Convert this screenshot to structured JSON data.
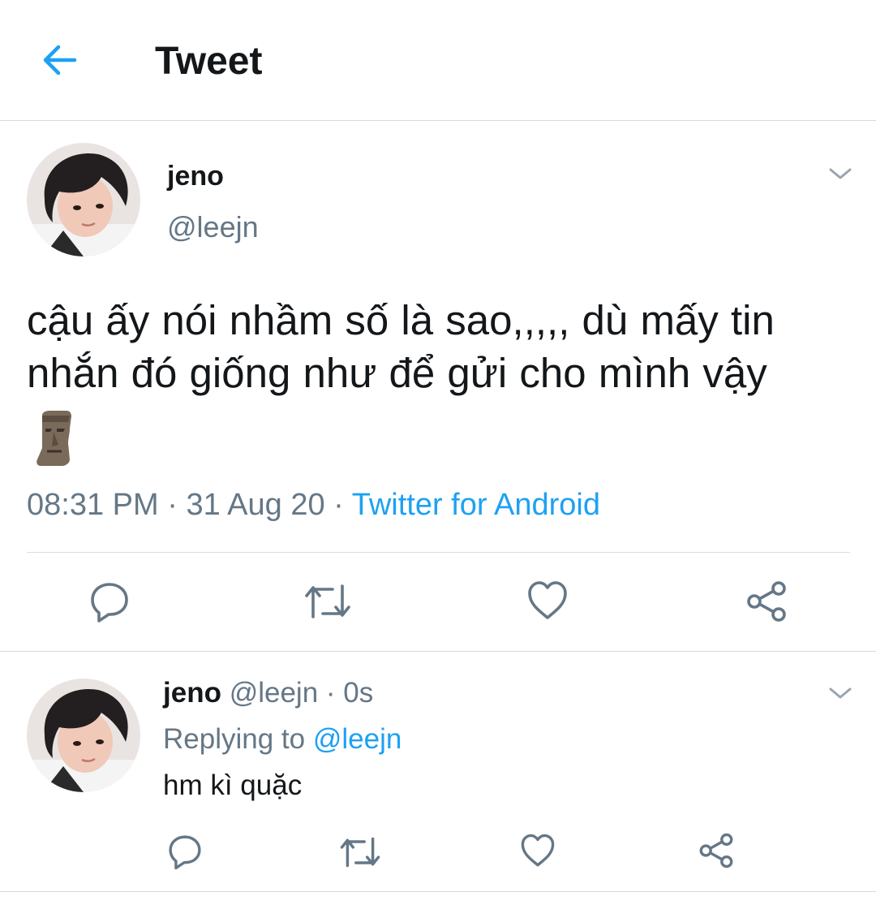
{
  "header": {
    "title": "Tweet",
    "back_icon": "arrow-left-icon"
  },
  "tweet": {
    "author_name": "jeno",
    "author_handle": "@leejn",
    "text": "cậu ấy nói nhầm số là sao,,,,, dù mấy tin nhắn đó giống như để gửi cho mình vậy",
    "emoji_icon": "moai-icon",
    "time": "08:31 PM",
    "separator": " · ",
    "date": "31 Aug 20",
    "source": "Twitter for Android",
    "actions": [
      "reply-icon",
      "retweet-icon",
      "like-icon",
      "share-icon"
    ]
  },
  "reply": {
    "author_name": "jeno",
    "author_handle": "@leejn",
    "time_ago": "0s",
    "replying_label": "Replying to",
    "replying_to": "@leejn",
    "text": "hm kì quặc"
  },
  "colors": {
    "accent": "#1da1f2",
    "muted": "#657786",
    "text": "#14171a",
    "divider": "#d6dbe0"
  }
}
